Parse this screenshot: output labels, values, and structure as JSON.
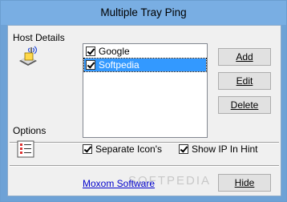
{
  "window": {
    "title": "Multiple Tray Ping"
  },
  "host_details": {
    "heading": "Host Details",
    "icon": "network-host-icon",
    "hosts": [
      {
        "label": "Google",
        "checked": true,
        "selected": false
      },
      {
        "label": "Softpedia",
        "checked": true,
        "selected": true
      }
    ]
  },
  "buttons": {
    "add": "Add",
    "edit": "Edit",
    "delete": "Delete",
    "hide": "Hide"
  },
  "options": {
    "heading": "Options",
    "icon": "options-list-icon",
    "separate_icons": {
      "label": "Separate Icon's",
      "checked": true
    },
    "show_ip": {
      "label": "Show IP In Hint",
      "checked": true
    }
  },
  "footer": {
    "link": "Moxom Software"
  },
  "watermark": "SOFTPEDIA"
}
